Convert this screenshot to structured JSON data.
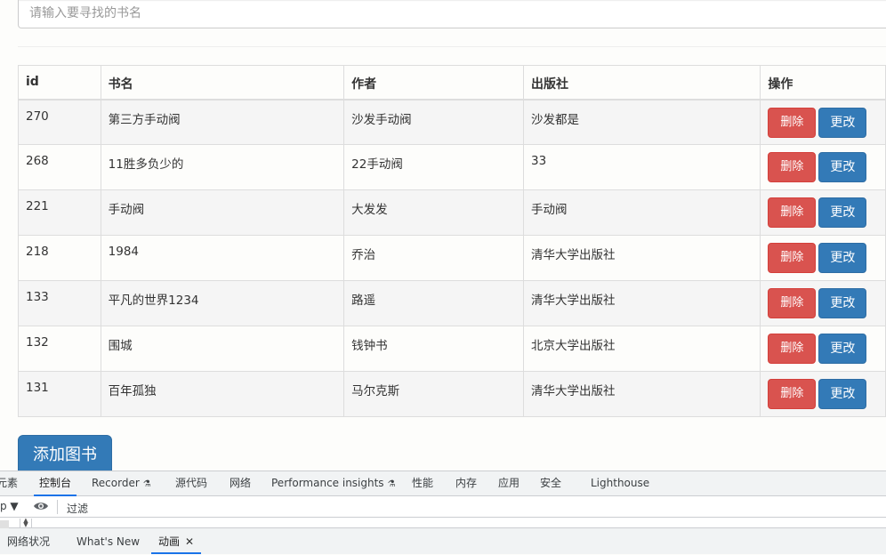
{
  "search": {
    "placeholder": "请输入要寻找的书名",
    "value": ""
  },
  "table": {
    "headers": {
      "id": "id",
      "name": "书名",
      "author": "作者",
      "publisher": "出版社",
      "ops": "操作"
    },
    "rows": [
      {
        "id": "270",
        "name": "第三方手动阀",
        "author": "沙发手动阀",
        "publisher": "沙发都是"
      },
      {
        "id": "268",
        "name": "11胜多负少的",
        "author": "22手动阀",
        "publisher": "33"
      },
      {
        "id": "221",
        "name": "手动阀",
        "author": "大发发",
        "publisher": "手动阀"
      },
      {
        "id": "218",
        "name": "1984",
        "author": "乔治",
        "publisher": "清华大学出版社"
      },
      {
        "id": "133",
        "name": "平凡的世界1234",
        "author": "路遥",
        "publisher": "清华大学出版社"
      },
      {
        "id": "132",
        "name": "围城",
        "author": "钱钟书",
        "publisher": "北京大学出版社"
      },
      {
        "id": "131",
        "name": "百年孤独",
        "author": "马尔克斯",
        "publisher": "清华大学出版社"
      }
    ],
    "delete_label": "删除",
    "edit_label": "更改"
  },
  "add_button": {
    "label": "添加图书"
  },
  "devtools": {
    "tabs": [
      {
        "label": "元素"
      },
      {
        "label": "控制台",
        "active": true
      },
      {
        "label": "Recorder",
        "icon": "flask-icon"
      },
      {
        "label": "源代码"
      },
      {
        "label": "网络"
      },
      {
        "label": "Performance insights",
        "icon": "flask-icon"
      },
      {
        "label": "性能"
      },
      {
        "label": "内存"
      },
      {
        "label": "应用"
      },
      {
        "label": "安全"
      },
      {
        "label": "Lighthouse"
      }
    ],
    "console": {
      "context_label": "p ▼",
      "filter_placeholder": "过滤"
    },
    "drawer_tabs": [
      {
        "label": "网络状况"
      },
      {
        "label": "What's New"
      },
      {
        "label": "动画",
        "active": true,
        "closable": true
      }
    ]
  },
  "colors": {
    "danger": "#d9534f",
    "primary": "#337ab7",
    "devtools_active": "#1a73e8"
  }
}
